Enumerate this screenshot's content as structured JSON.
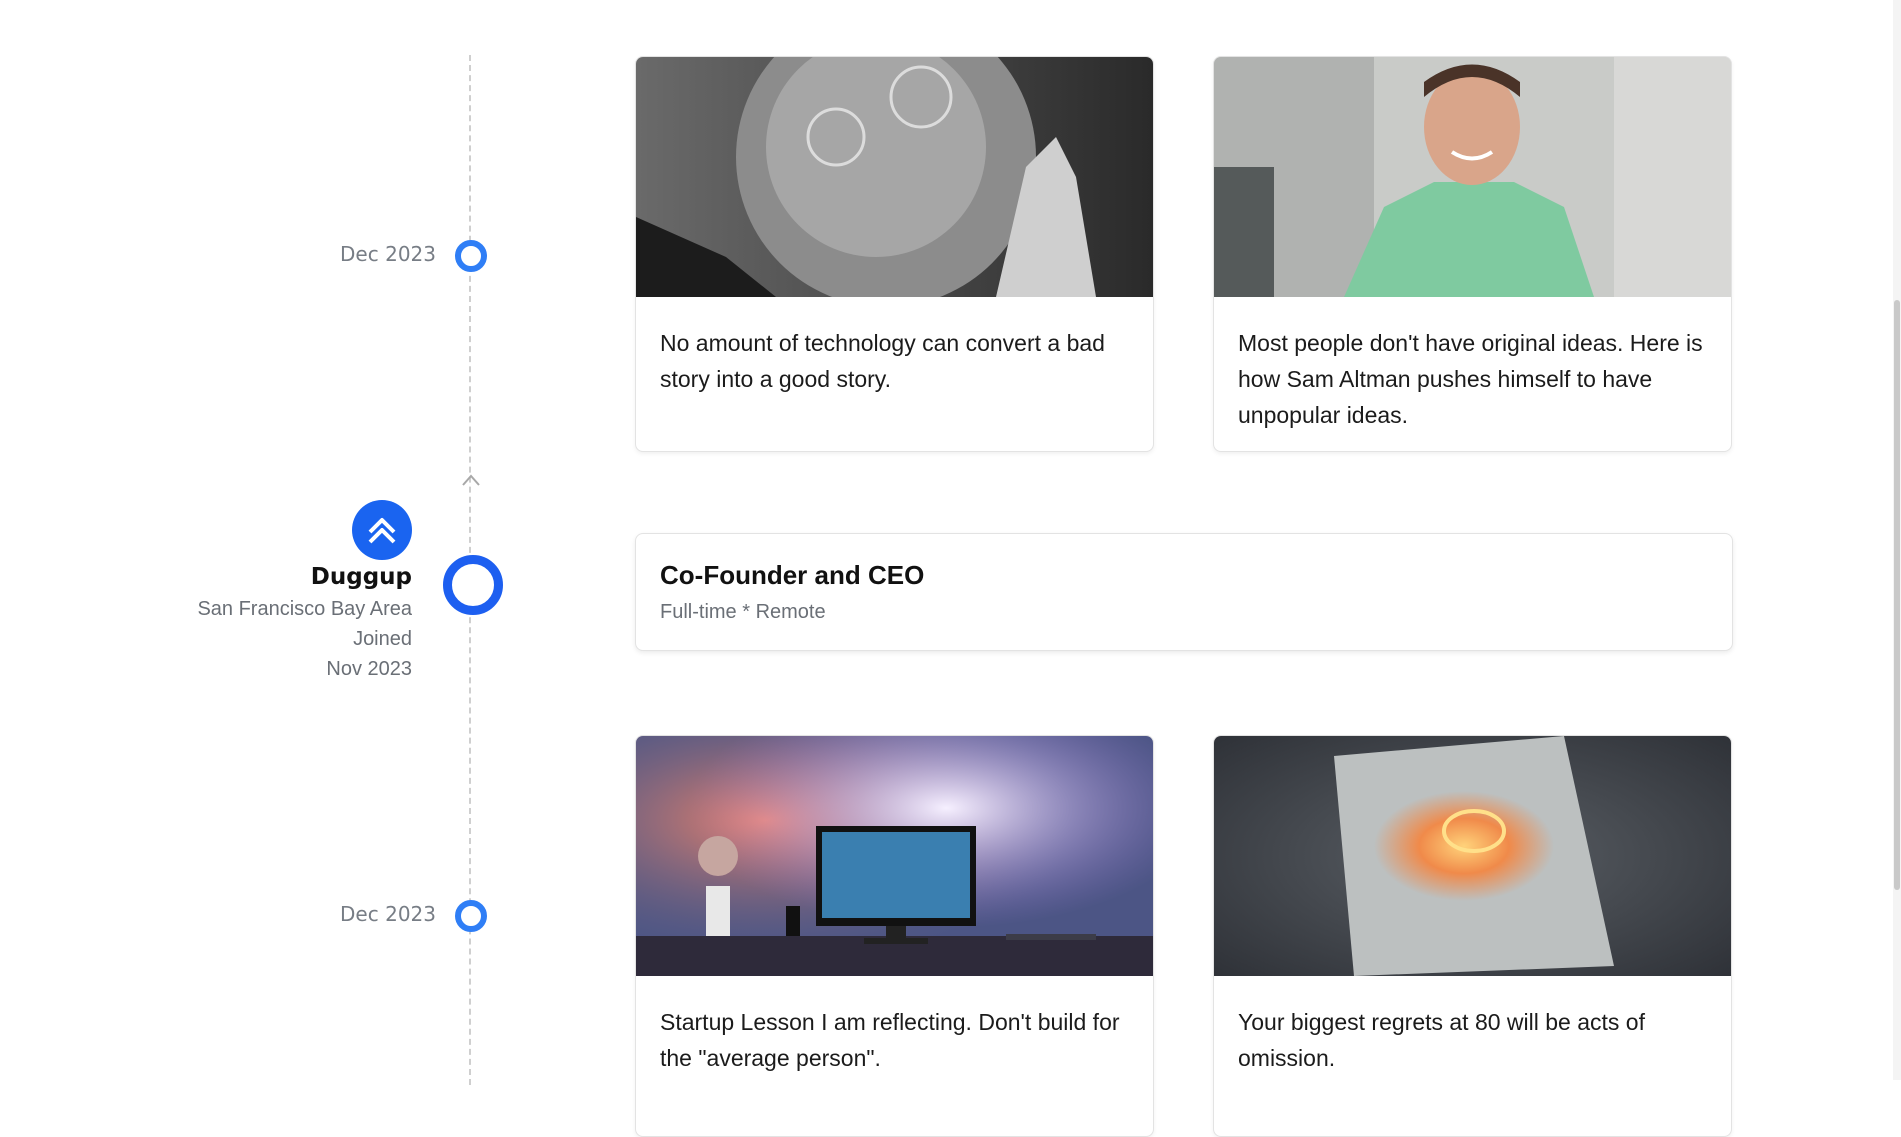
{
  "timeline": {
    "entries": [
      {
        "date": "Dec 2023"
      },
      {
        "date": "Dec 2023"
      }
    ]
  },
  "company": {
    "name": "Duggup",
    "location": "San Francisco Bay Area",
    "joined_label": "Joined",
    "joined_date": "Nov 2023",
    "logo_icon": "duggup-logo-icon",
    "brand_color": "#1a64f0"
  },
  "role": {
    "title": "Co-Founder and CEO",
    "subtitle": "Full-time * Remote"
  },
  "posts": [
    {
      "image": "portrait-bw-man-glasses",
      "text": "No amount of technology can convert a bad story into a good story."
    },
    {
      "image": "portrait-man-green-shirt",
      "text": "Most people don't have original ideas. Here is how Sam Altman pushes himself to have unpopular ideas."
    },
    {
      "image": "desk-setup-photo",
      "text": "Startup Lesson I am reflecting. Don't build for the \"average person\"."
    },
    {
      "image": "glowing-map-photo",
      "text": "Your biggest regrets at 80 will be acts of omission."
    }
  ],
  "colors": {
    "accent": "#2f7ef6",
    "node_dark": "#1d5ff0"
  }
}
